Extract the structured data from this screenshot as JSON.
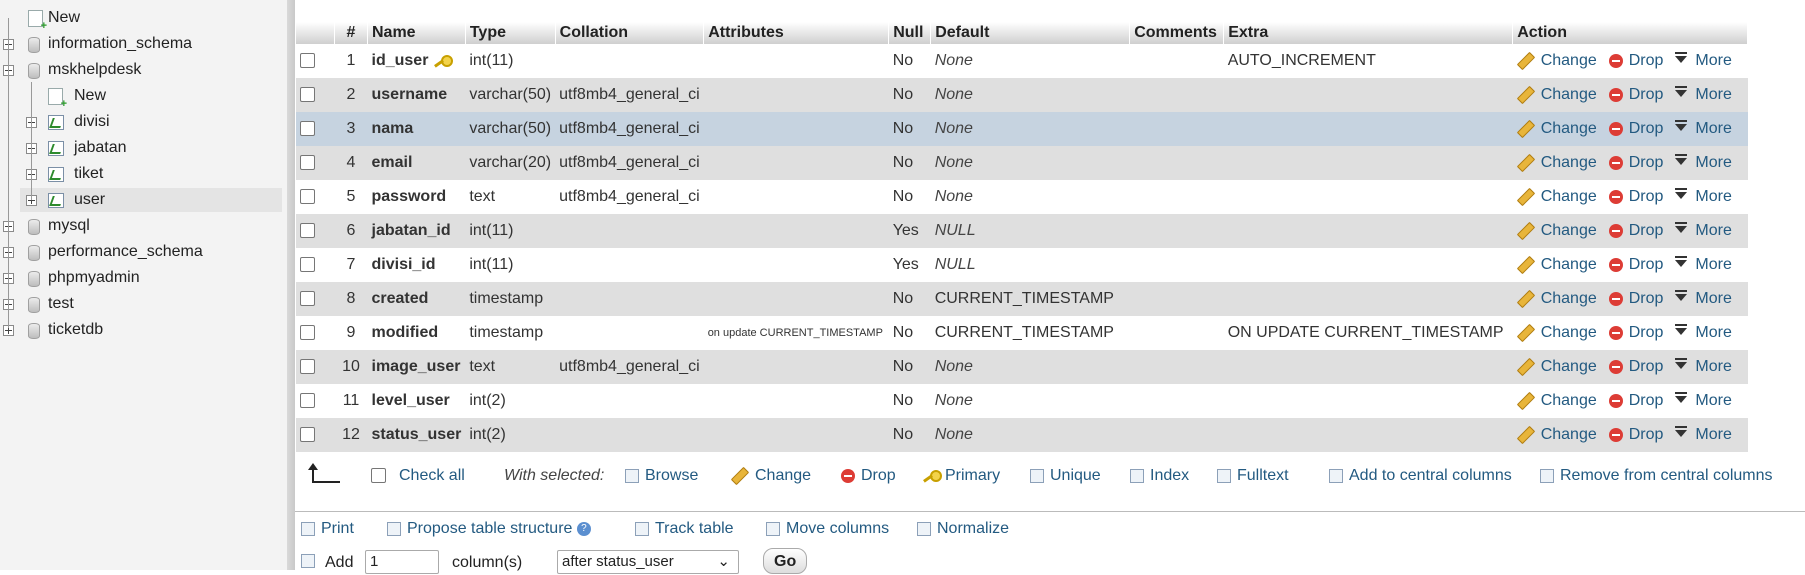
{
  "sidebar": {
    "nodes": [
      {
        "label": "New",
        "kind": "new",
        "level": 0
      },
      {
        "label": "information_schema",
        "kind": "db",
        "level": 0
      },
      {
        "label": "mskhelpdesk",
        "kind": "db",
        "level": 0
      },
      {
        "label": "New",
        "kind": "new",
        "level": 1
      },
      {
        "label": "divisi",
        "kind": "table",
        "level": 1
      },
      {
        "label": "jabatan",
        "kind": "table",
        "level": 1
      },
      {
        "label": "tiket",
        "kind": "table",
        "level": 1
      },
      {
        "label": "user",
        "kind": "table",
        "level": 1,
        "selected": true
      },
      {
        "label": "mysql",
        "kind": "db",
        "level": 0
      },
      {
        "label": "performance_schema",
        "kind": "db",
        "level": 0
      },
      {
        "label": "phpmyadmin",
        "kind": "db",
        "level": 0
      },
      {
        "label": "test",
        "kind": "db",
        "level": 0
      },
      {
        "label": "ticketdb",
        "kind": "db",
        "level": 0
      }
    ]
  },
  "structure": {
    "headers": {
      "num": "#",
      "name": "Name",
      "type": "Type",
      "collation": "Collation",
      "attributes": "Attributes",
      "null": "Null",
      "default": "Default",
      "comments": "Comments",
      "extra": "Extra",
      "action": "Action"
    },
    "actions": {
      "change": "Change",
      "drop": "Drop",
      "more": "More"
    },
    "rows": [
      {
        "num": "1",
        "name": "id_user",
        "type": "int(11)",
        "collation": "",
        "attributes": "",
        "null": "No",
        "default": "None",
        "extra": "AUTO_INCREMENT",
        "primary": true
      },
      {
        "num": "2",
        "name": "username",
        "type": "varchar(50)",
        "collation": "utf8mb4_general_ci",
        "attributes": "",
        "null": "No",
        "default": "None",
        "extra": ""
      },
      {
        "num": "3",
        "name": "nama",
        "type": "varchar(50)",
        "collation": "utf8mb4_general_ci",
        "attributes": "",
        "null": "No",
        "default": "None",
        "extra": "",
        "highlight": true
      },
      {
        "num": "4",
        "name": "email",
        "type": "varchar(20)",
        "collation": "utf8mb4_general_ci",
        "attributes": "",
        "null": "No",
        "default": "None",
        "extra": ""
      },
      {
        "num": "5",
        "name": "password",
        "type": "text",
        "collation": "utf8mb4_general_ci",
        "attributes": "",
        "null": "No",
        "default": "None",
        "extra": ""
      },
      {
        "num": "6",
        "name": "jabatan_id",
        "type": "int(11)",
        "collation": "",
        "attributes": "",
        "null": "Yes",
        "default": "NULL",
        "extra": ""
      },
      {
        "num": "7",
        "name": "divisi_id",
        "type": "int(11)",
        "collation": "",
        "attributes": "",
        "null": "Yes",
        "default": "NULL",
        "extra": ""
      },
      {
        "num": "8",
        "name": "created",
        "type": "timestamp",
        "collation": "",
        "attributes": "",
        "null": "No",
        "default": "CURRENT_TIMESTAMP",
        "extra": ""
      },
      {
        "num": "9",
        "name": "modified",
        "type": "timestamp",
        "collation": "",
        "attributes": "on update CURRENT_TIMESTAMP",
        "null": "No",
        "default": "CURRENT_TIMESTAMP",
        "extra": "ON UPDATE CURRENT_TIMESTAMP"
      },
      {
        "num": "10",
        "name": "image_user",
        "type": "text",
        "collation": "utf8mb4_general_ci",
        "attributes": "",
        "null": "No",
        "default": "None",
        "extra": ""
      },
      {
        "num": "11",
        "name": "level_user",
        "type": "int(2)",
        "collation": "",
        "attributes": "",
        "null": "No",
        "default": "None",
        "extra": ""
      },
      {
        "num": "12",
        "name": "status_user",
        "type": "int(2)",
        "collation": "",
        "attributes": "",
        "null": "No",
        "default": "None",
        "extra": ""
      }
    ]
  },
  "bulk": {
    "check_all": "Check all",
    "with_selected": "With selected:",
    "browse": "Browse",
    "change": "Change",
    "drop": "Drop",
    "primary": "Primary",
    "unique": "Unique",
    "index": "Index",
    "fulltext": "Fulltext",
    "add_central": "Add to central columns",
    "remove_central": "Remove from central columns"
  },
  "toolbar": {
    "print": "Print",
    "propose": "Propose table structure",
    "track": "Track table",
    "move": "Move columns",
    "normalize": "Normalize"
  },
  "add_columns": {
    "label": "Add",
    "count": "1",
    "unit": "column(s)",
    "position": "after status_user",
    "go": "Go"
  }
}
